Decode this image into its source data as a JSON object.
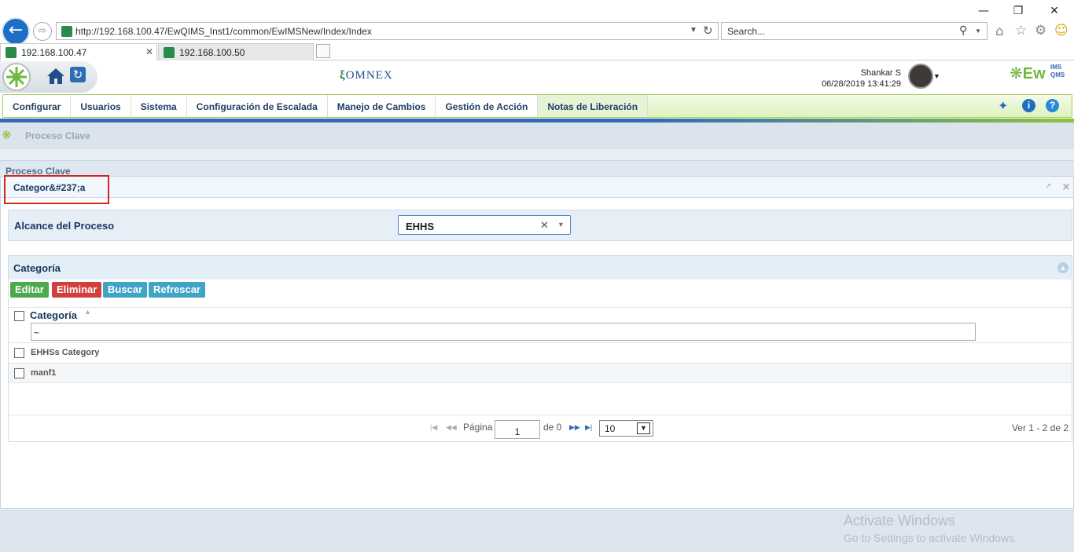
{
  "browser": {
    "url": "http://192.168.100.47/EwQIMS_Inst1/common/EwIMSNew/Index/Index",
    "search_placeholder": "Search...",
    "tabs": [
      {
        "label": "192.168.100.47"
      },
      {
        "label": "192.168.100.50"
      }
    ]
  },
  "header": {
    "user_name": "Shankar S",
    "datetime": "06/28/2019 13:41:29",
    "omnex_logo": "OMNEX",
    "brand_logo": "Ew",
    "brand_suffix": "IMS",
    "brand_suffix2": "QMS"
  },
  "nav": {
    "items": [
      {
        "label": "Configurar"
      },
      {
        "label": "Usuarios"
      },
      {
        "label": "Sistema"
      },
      {
        "label": "Configuración de Escalada"
      },
      {
        "label": "Manejo de Cambios"
      },
      {
        "label": "Gestión de Acción"
      },
      {
        "label": "Notas de Liberación"
      }
    ]
  },
  "breadcrumb": {
    "label": "Proceso Clave"
  },
  "section": {
    "title": "Proceso Clave"
  },
  "panel": {
    "title": "Categor&#237;a"
  },
  "filter": {
    "label": "Alcance del Proceso",
    "selected": "EHHS"
  },
  "grid": {
    "title": "Categoría",
    "buttons": {
      "edit": "Editar",
      "delete": "Eliminar",
      "search": "Buscar",
      "refresh": "Refrescar"
    },
    "column_header": "Categoría",
    "filter_value": "~",
    "rows": [
      {
        "label": "EHHSs Category"
      },
      {
        "label": "manf1"
      }
    ],
    "pager": {
      "page_label": "Página",
      "page": "1",
      "of_label": "de 0",
      "page_size": "10",
      "summary": "Ver 1 - 2 de 2"
    }
  },
  "watermark": {
    "line1": "Activate Windows",
    "line2": "Go to Settings to activate Windows."
  },
  "colors": {
    "edit": "#4ea84e",
    "delete": "#d23f3f",
    "search": "#3fa4c6",
    "refresh": "#3fa4c6",
    "nav_text": "#1d3f66"
  }
}
